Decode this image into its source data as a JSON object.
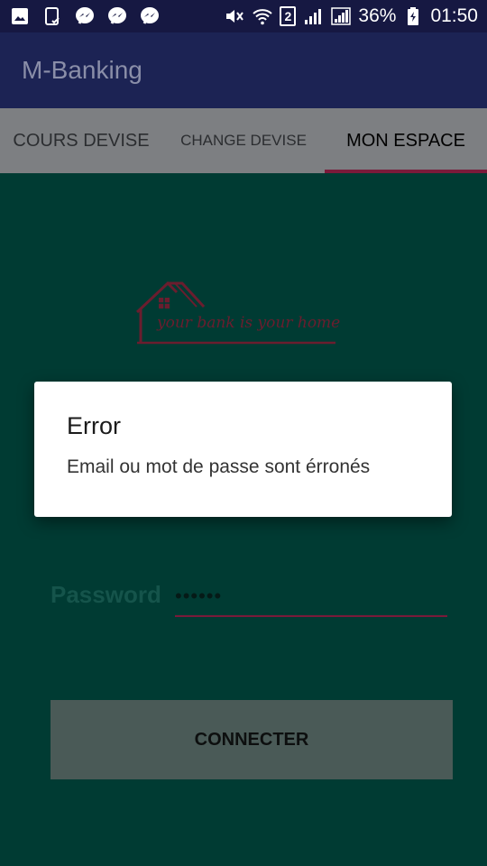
{
  "status_bar": {
    "battery": "36%",
    "time": "01:50",
    "sim": "2",
    "icons": [
      "gallery-icon",
      "file-check-icon",
      "messenger-icon",
      "messenger-icon",
      "messenger-icon",
      "mute-icon",
      "wifi-icon",
      "signal-icon",
      "signal-icon",
      "battery-charging-icon"
    ]
  },
  "app": {
    "title": "M-Banking"
  },
  "tabs": [
    {
      "label": "COURS DEVISE",
      "selected": false
    },
    {
      "label": "CHANGE DEVISE",
      "selected": false
    },
    {
      "label": "MON ESPACE",
      "selected": true
    }
  ],
  "logo": {
    "tagline": "your bank is your home"
  },
  "form": {
    "password_label": "Password",
    "password_value": "••••••",
    "connect_label": "CONNECTER"
  },
  "dialog": {
    "title": "Error",
    "message": "Email ou mot de passe sont érronés"
  },
  "colors": {
    "status_bar": "#161842",
    "app_bar": "#1c2354",
    "tab_bar": "#7d7f82",
    "tab_indicator": "#7a1a3a",
    "content_bg": "#003b33",
    "button_bg": "#4a5a57"
  }
}
